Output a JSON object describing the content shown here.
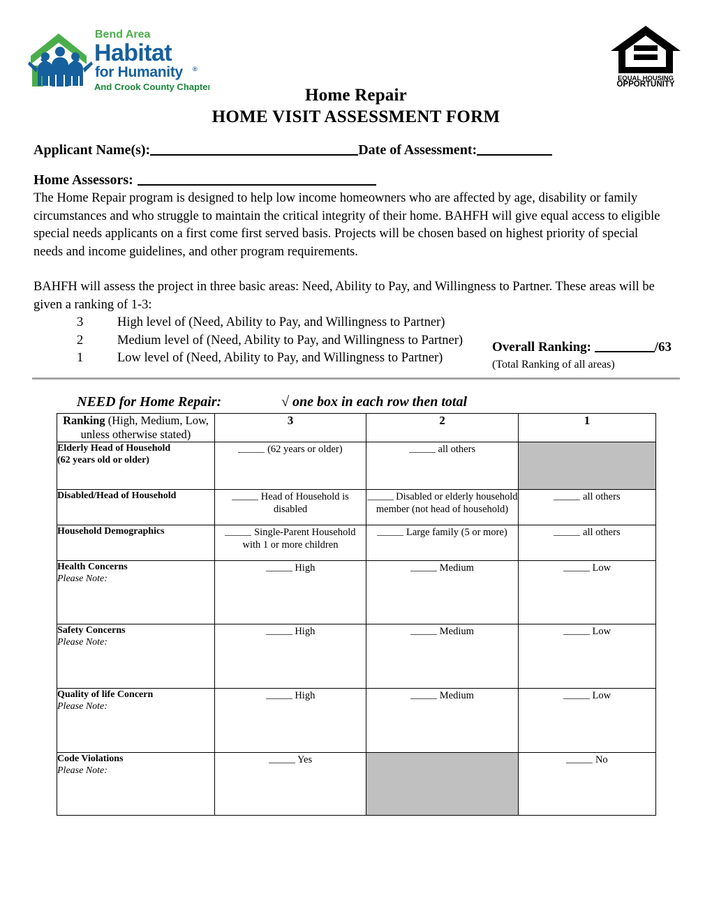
{
  "logos": {
    "habitat": {
      "name": "bend-area-habitat-for-humanity-logo",
      "line_top": "Bend Area",
      "line_main": "Habitat",
      "line_sub": "for Humanity",
      "registered": "®",
      "line_bottom": "And Crook County Chapter",
      "green": "#4AAE4A",
      "blue": "#16609E"
    },
    "equal_housing": {
      "name": "equal-housing-opportunity-logo",
      "line1": "EQUAL HOUSING",
      "line2": "OPPORTUNITY"
    }
  },
  "title": {
    "line1": "Home Repair",
    "line2": "HOME VISIT ASSESSMENT FORM"
  },
  "fields": {
    "applicant_label": "Applicant Name(s):",
    "applicant_value": "",
    "date_label": "Date of Assessment:",
    "date_value": "",
    "assessors_label": "Home Assessors:",
    "assessors_value": ""
  },
  "body": {
    "paragraph1": "The Home Repair program is designed to help low income homeowners who are affected by age, disability or family circumstances and who struggle to maintain the critical integrity of their home. BAHFH will give equal access to eligible special needs applicants on a first come first served basis. Projects will be chosen based on highest priority of special needs and income guidelines, and other program requirements.",
    "paragraph2": "BAHFH will assess the project in three basic areas: Need, Ability to Pay, and Willingness to Partner. These areas will be given a ranking of 1-3:",
    "ranking_key": [
      {
        "num": "3",
        "text": "High level of (Need, Ability to Pay, and Willingness to Partner)"
      },
      {
        "num": "2",
        "text": "Medium level of (Need, Ability to Pay, and Willingness to Partner)"
      },
      {
        "num": "1",
        "text": "Low level of (Need, Ability to Pay, and Willingness to Partner)"
      }
    ]
  },
  "overall": {
    "label": "Overall Ranking:",
    "value": "",
    "max_suffix": "/63",
    "note": "(Total Ranking of all areas)"
  },
  "need_section": {
    "caption_left": "NEED for Home Repair:",
    "caption_right": "√ one box in each row then total",
    "table": {
      "header": {
        "label_bold": "Ranking",
        "label_rest": " (High, Medium, Low, unless otherwise stated)",
        "col3": "3",
        "col2": "2",
        "col1": "1"
      },
      "rows": [
        {
          "label": "Elderly Head of Household",
          "label2": "(62 years old or older)",
          "please_note": "",
          "c3": "(62 years or older)",
          "c2": "all others",
          "c1": "",
          "c1_shaded": true
        },
        {
          "label": "Disabled/Head of Household",
          "label2": "",
          "please_note": "",
          "c3": "Head of Household is disabled",
          "c2": "Disabled or elderly household member (not head of household)",
          "c1": "all others",
          "c1_shaded": false
        },
        {
          "label": "Household Demographics",
          "label2": "",
          "please_note": "",
          "c3": "Single-Parent Household with 1 or more children",
          "c2": "Large family (5 or more)",
          "c1": "all others",
          "c1_shaded": false
        },
        {
          "label": "Health Concerns",
          "label2": "",
          "please_note": "Please Note:",
          "c3": "High",
          "c2": "Medium",
          "c1": "Low",
          "c1_shaded": false
        },
        {
          "label": "Safety Concerns",
          "label2": "",
          "please_note": "Please Note:",
          "c3": "High",
          "c2": "Medium",
          "c1": "Low",
          "c1_shaded": false
        },
        {
          "label": "Quality of life Concern",
          "label2": "",
          "please_note": "Please Note:",
          "c3": "High",
          "c2": "Medium",
          "c1": "Low",
          "c1_shaded": false
        },
        {
          "label": "Code Violations",
          "label2": "",
          "please_note": "Please Note:",
          "c3": "Yes",
          "c2": "",
          "c2_shaded": true,
          "c1": "No",
          "c1_shaded": false
        }
      ]
    }
  },
  "colors": {
    "shaded_cell": "#C0C0C0",
    "divider": "#A6A6A6"
  }
}
